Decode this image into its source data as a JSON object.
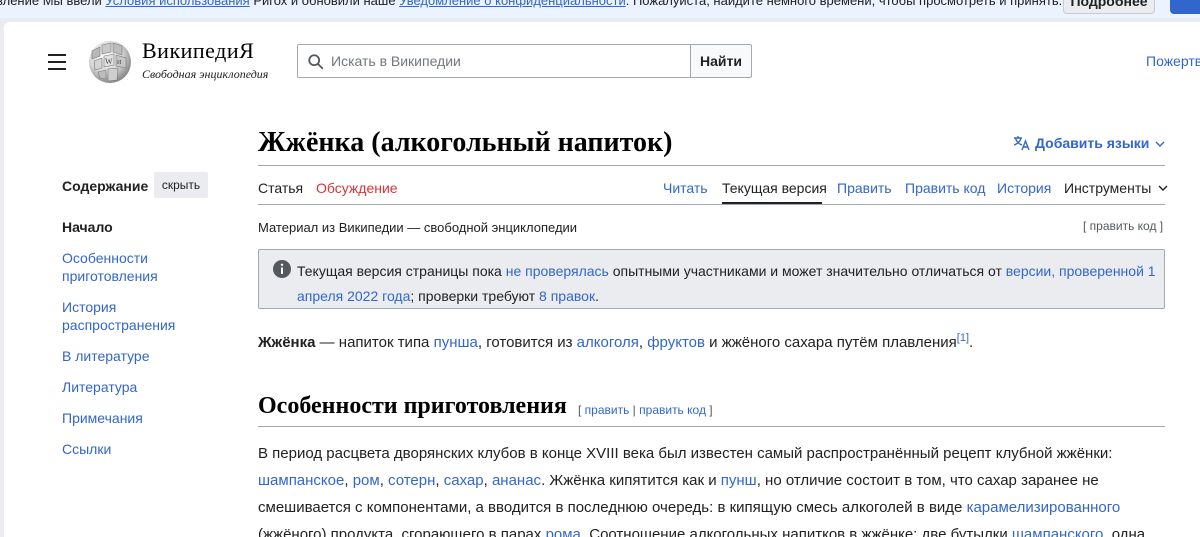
{
  "site_notice": {
    "part1": "вление Мы ввели ",
    "link1": "Условия использования",
    "part2": " Ригох и обновили наше ",
    "link2": "Уведомление о конфиденциальности",
    "part3": ". Пожалуйста, найдите немного времени, чтобы просмотреть и принять.",
    "more_label": "Подробнее"
  },
  "header": {
    "wordmark": "ВикипедиЯ",
    "tagline": "Свободная энциклопедия",
    "search_placeholder": "Искать в Википедии",
    "search_button": "Найти",
    "donate": "Пожертв"
  },
  "toc": {
    "title": "Содержание",
    "hide_label": "скрыть",
    "items": [
      "Начало",
      "Особенности приготовления",
      "История распространения",
      "В литературе",
      "Литература",
      "Примечания",
      "Ссылки"
    ]
  },
  "article": {
    "title": "Жжёнка (алкогольный напиток)",
    "add_languages": "Добавить языки",
    "tabs": {
      "article": "Статья",
      "talk": "Обсуждение",
      "read": "Читать",
      "current": "Текущая версия",
      "edit": "Править",
      "edit_source": "Править код",
      "history": "История",
      "tools": "Инструменты"
    },
    "from_wiki": "Материал из Википедии — свободной энциклопедии",
    "edit_code_section": "[ править код ]",
    "flagged": {
      "t1": "Текущая версия страницы пока ",
      "l1": "не проверялась",
      "t2": " опытными участниками и может значительно отличаться от ",
      "l2": "версии, проверенной 1 апреля 2022 года",
      "t3": "; проверки требуют ",
      "l3": "8 правок",
      "t4": "."
    },
    "lead": {
      "bold": "Жжёнка",
      "t1": " — напиток типа ",
      "l1": "пунша",
      "t2": ", готовится из ",
      "l2": "алкоголя",
      "t3": ", ",
      "l3": "фруктов",
      "t4": " и жжёного сахара путём плавления",
      "ref": "[1]",
      "t5": "."
    },
    "section": {
      "title": "Особенности приготовления",
      "edit_open": "[ ",
      "edit": "править",
      "sep": " | ",
      "edit_source": "править код",
      "edit_close": " ]"
    },
    "paragraph": {
      "t1": "В период расцвета дворянских клубов в конце XVIII века был известен самый распространённый рецепт клубной жжёнки: ",
      "l1": "шампанское",
      "t2": ", ",
      "l2": "ром",
      "t3": ", ",
      "l3": "сотерн",
      "t4": ", ",
      "l4": "сахар",
      "t5": ", ",
      "l5": "ананас",
      "t6": ". Жжёнка кипятится как и ",
      "l6": "пунш",
      "t7": ", но отличие состоит в том, что сахар заранее не смешивается с компонентами, а вводится в последнюю очередь: в кипящую смесь алкоголей в виде ",
      "l7": "карамелизированного",
      "t8": " (жжёного) продукта, сгорающего в парах ",
      "l8": "рома",
      "t9": ". Соотношение алкогольных напитков в жжёнке: две бутылки ",
      "l9": "шампанского",
      "t10": ", одна"
    }
  }
}
